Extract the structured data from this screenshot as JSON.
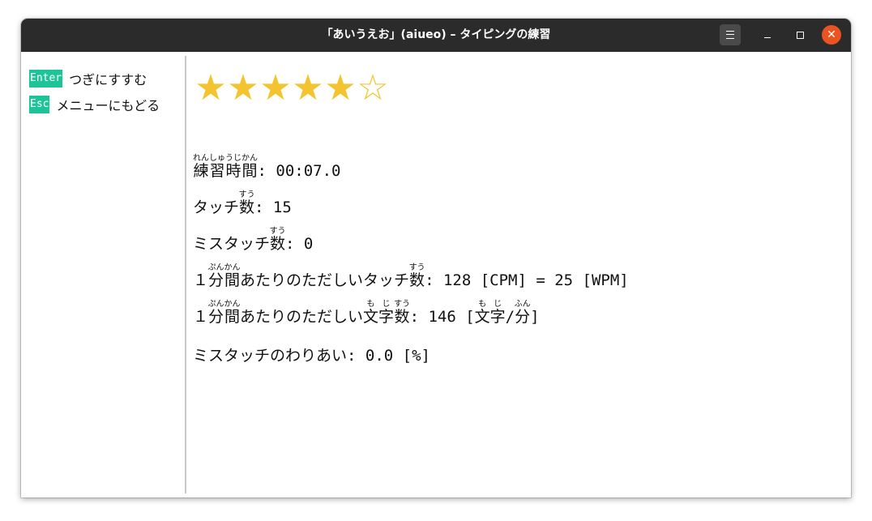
{
  "window": {
    "title": "「あいうえお」(aiueo) – タイピングの練習",
    "accent_color": "#e95420",
    "titlebar_color": "#2b2b2b",
    "buttons": {
      "menu_icon": "hamburger-icon",
      "minimize_icon": "minimize-icon",
      "maximize_icon": "maximize-icon",
      "close_icon": "close-icon"
    }
  },
  "sidebar": {
    "key_color": "#1dc497",
    "items": [
      {
        "key": "Enter",
        "label": "つぎにすすむ"
      },
      {
        "key": "Esc",
        "label": "メニューにもどる"
      }
    ]
  },
  "result": {
    "rating": 5,
    "rating_max": 6,
    "star_color": "#f4c430",
    "filled_star": "★",
    "empty_star": "☆",
    "stats": {
      "time": {
        "base": "練習時間",
        "ruby": "れんしゅうじかん",
        "sep": ": ",
        "value": "00:07.0"
      },
      "touches": {
        "pre": "タッチ",
        "kanji": "数",
        "ruby": "すう",
        "sep": ": ",
        "value": "15"
      },
      "mistouches": {
        "pre": "ミスタッチ",
        "kanji": "数",
        "ruby": "すう",
        "sep": ": ",
        "value": "0"
      },
      "touch_rate": {
        "lead": "１",
        "kanji1": "分間",
        "ruby1": "ぷんかん",
        "mid": "あたりのただしいタッチ",
        "kanji2": "数",
        "ruby2": "すう",
        "sep": ": ",
        "value": "128 [CPM] = 25 [WPM]"
      },
      "char_rate": {
        "lead": "１",
        "kanji1": "分間",
        "ruby1": "ぷんかん",
        "mid": "あたりのただしい",
        "kanji2": "文字",
        "ruby2": "もじ",
        "kanji3": "数",
        "ruby3": "すう",
        "value_pre": ": 146 [",
        "kanji4": "文字",
        "ruby4": "もじ",
        "slash": "/",
        "kanji5": "分",
        "ruby5": "ふん",
        "value_post": "]"
      },
      "miss_ratio": {
        "label": "ミスタッチのわりあい",
        "sep": ": ",
        "value": "0.0 [%]"
      }
    }
  }
}
